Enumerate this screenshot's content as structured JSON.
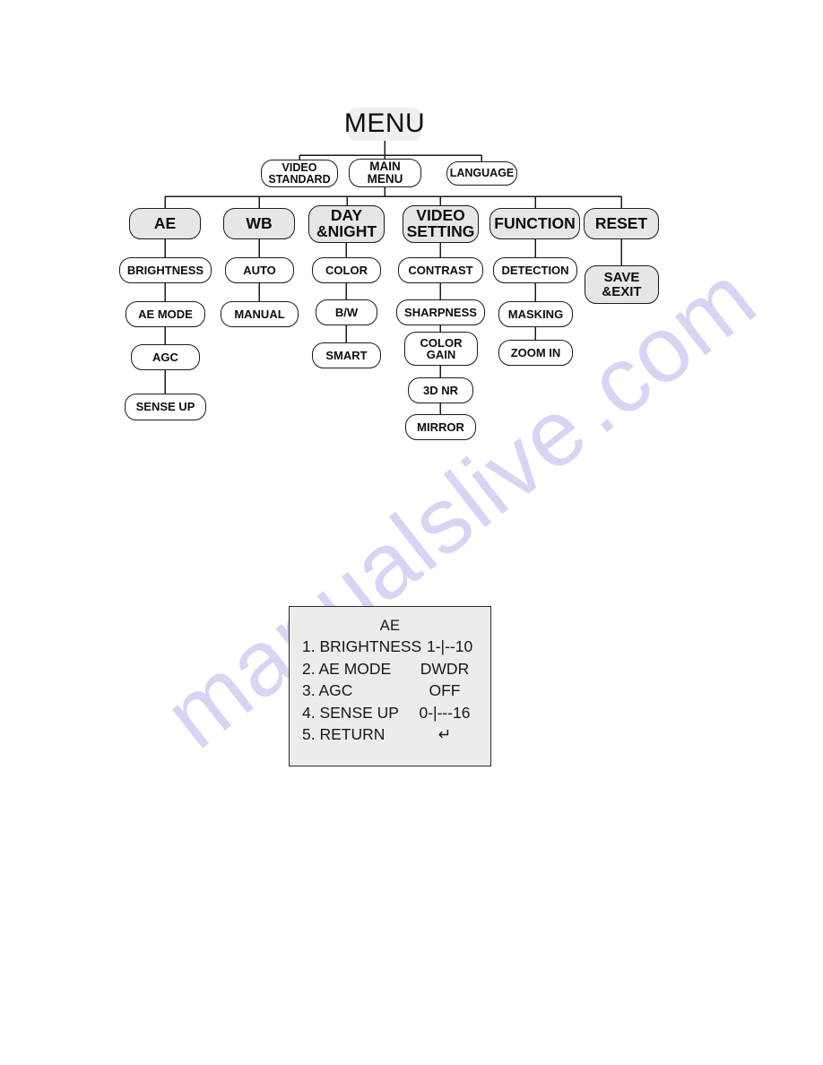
{
  "watermark": {
    "line1": "manualslive",
    "line2": ".com"
  },
  "diagram": {
    "root": {
      "label": "MENU"
    },
    "level1": [
      {
        "label": "VIDEO\nSTANDARD"
      },
      {
        "label": "MAIN\nMENU"
      },
      {
        "label": "LANGUAGE"
      }
    ],
    "columns": [
      {
        "head": "AE",
        "items": [
          "BRIGHTNESS",
          "AE MODE",
          "AGC",
          "SENSE UP"
        ]
      },
      {
        "head": "WB",
        "items": [
          "AUTO",
          "MANUAL"
        ]
      },
      {
        "head": "DAY\n&NIGHT",
        "items": [
          "COLOR",
          "B/W",
          "SMART"
        ]
      },
      {
        "head": "VIDEO\nSETTING",
        "items": [
          "CONTRAST",
          "SHARPNESS",
          "COLOR\nGAIN",
          "3D NR",
          "MIRROR"
        ]
      },
      {
        "head": "FUNCTION",
        "items": [
          "DETECTION",
          "MASKING",
          "ZOOM IN"
        ]
      },
      {
        "head": "RESET",
        "items": [
          "SAVE\n&EXIT"
        ]
      }
    ]
  },
  "osd": {
    "title": "AE",
    "rows": [
      {
        "label": "1. BRIGHTNESS",
        "value": "1-|--10"
      },
      {
        "label": "2. AE MODE",
        "value": "DWDR"
      },
      {
        "label": "3. AGC",
        "value": "OFF"
      },
      {
        "label": "4. SENSE UP",
        "value": "0-|---16"
      },
      {
        "label": "5. RETURN",
        "value": "↵"
      }
    ]
  },
  "colors": {
    "node_fill_gray": "#e6e6e6",
    "node_fill_white": "#ffffff",
    "node_border": "#1a1a1a",
    "osd_fill": "#ececeb",
    "watermark": "#c9c6ef"
  }
}
